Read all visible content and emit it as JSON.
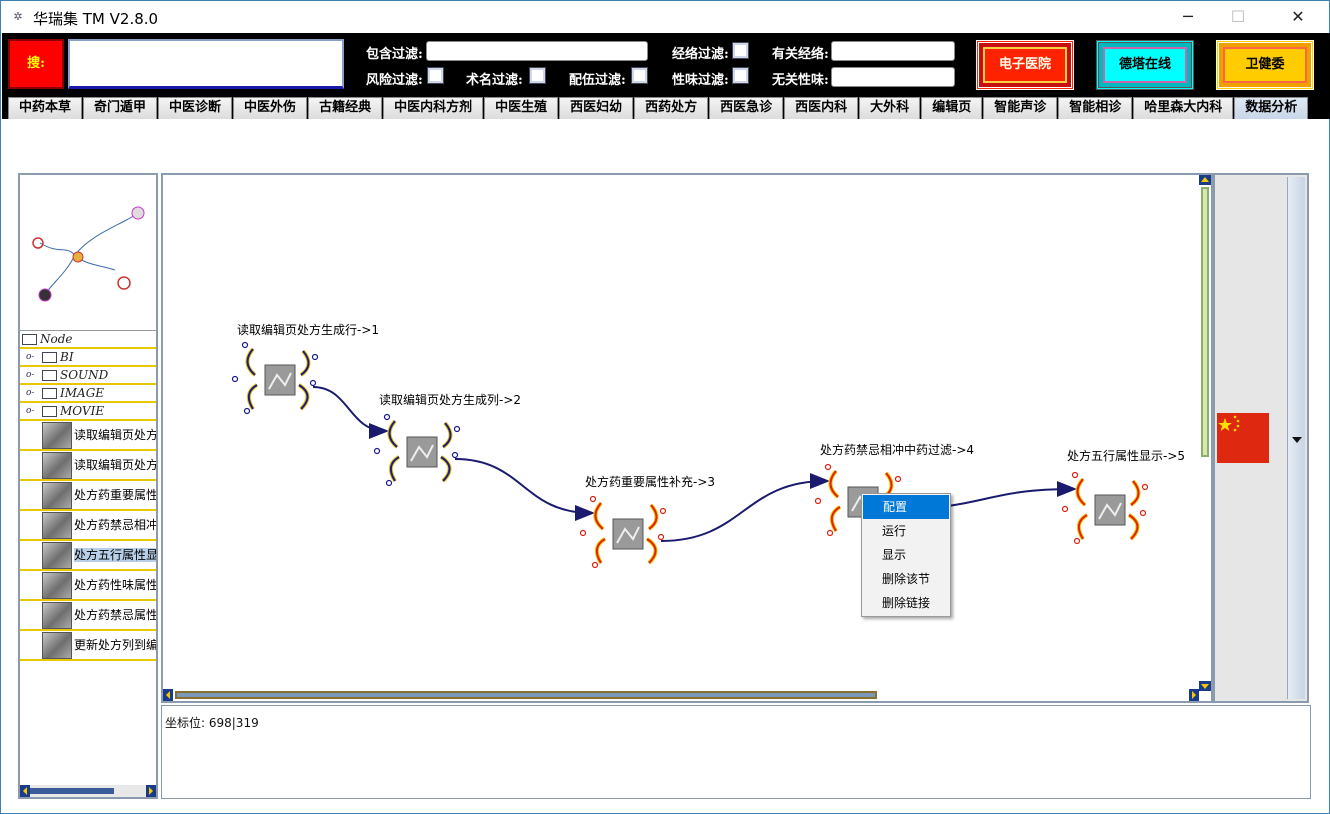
{
  "window": {
    "title": "华瑞集 TM V2.8.0",
    "minimize": "─",
    "maximize": "☐",
    "close": "✕"
  },
  "toolbar": {
    "search_label": "搜:",
    "search_value": "",
    "filters": {
      "include": "包含过滤:",
      "meridian": "经络过滤:",
      "related_meridian": "有关经络:",
      "risk": "风险过滤:",
      "term": "术名过滤:",
      "compat": "配伍过滤:",
      "taste": "性味过滤:",
      "unrelated_taste": "无关性味:"
    },
    "buttons": {
      "hospital": "电子医院",
      "detaxian": "德塔在线",
      "weijianwei": "卫健委"
    }
  },
  "tabs": [
    "中药本草",
    "奇门遁甲",
    "中医诊断",
    "中医外伤",
    "古籍经典",
    "中医内科方剂",
    "中医生殖",
    "西医妇幼",
    "西药处方",
    "西医急诊",
    "西医内科",
    "大外科",
    "编辑页",
    "智能声诊",
    "智能相诊",
    "哈里森大内科",
    "数据分析"
  ],
  "active_tab": "数据分析",
  "tree": {
    "root": "Node",
    "folders": [
      "BI",
      "SOUND",
      "IMAGE",
      "MOVIE"
    ],
    "nodes": [
      "读取编辑页处方",
      "读取编辑页处方",
      "处方药重要属性",
      "处方药禁忌相冲",
      "处方五行属性显",
      "处方药性味属性",
      "处方药禁忌属性",
      "更新处方列到编"
    ],
    "selected_index": 4
  },
  "flow_nodes": [
    {
      "label": "读取编辑页处方生成行->1",
      "style": "blue"
    },
    {
      "label": "读取编辑页处方生成列->2",
      "style": "blue"
    },
    {
      "label": "处方药重要属性补充->3",
      "style": "red"
    },
    {
      "label": "处方药禁忌相冲中药过滤->4",
      "style": "red"
    },
    {
      "label": "处方五行属性显示->5",
      "style": "red"
    }
  ],
  "context_menu": {
    "items": [
      "配置",
      "运行",
      "显示",
      "删除该节",
      "删除链接"
    ],
    "highlighted": 0
  },
  "status": {
    "text": "坐标位: 698|319"
  },
  "colors": {
    "toolbar_bg": "#000000",
    "edge": "#1a1a6e",
    "menu_highlight": "#0078d7"
  }
}
